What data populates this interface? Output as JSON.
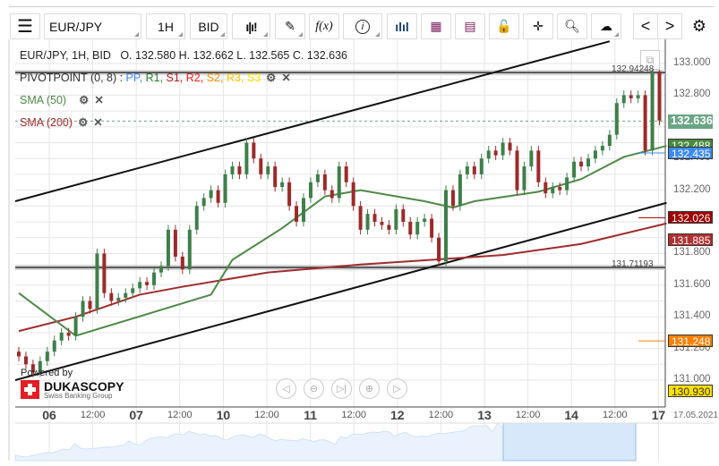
{
  "toolbar": {
    "menu_icon": "hamburger-icon",
    "symbol": "EUR/JPY",
    "period": "1H",
    "side": "BID",
    "chart_type_icon": "candles-icon",
    "draw_icon": "pencil-icon",
    "fx_label": "f(x)",
    "info_icon": "info-icon",
    "bars_icon": "volume-bars-icon",
    "calendar_icon": "calendar-icon",
    "news_icon": "news-icon",
    "lock_icon": "lock-icon",
    "crosshair_icon": "crosshair-icon",
    "zoom_icon": "zoom-icon",
    "upload_icon": "cloud-upload-icon",
    "prev": "<",
    "next": ">",
    "settings_icon": "gear-icon"
  },
  "header": {
    "title": "EUR/JPY, 1H, BID",
    "ohlc": "O. 132.580 H. 132.662 L. 132.565 C. 132.636"
  },
  "indicators": {
    "pivot": {
      "name": "PIVOTPOINT (0, 8)",
      "sep": " : ",
      "parts": [
        {
          "t": "PP",
          "c": "#3c8af0"
        },
        {
          "t": "R1",
          "c": "#2e7d32"
        },
        {
          "t": "S1",
          "c": "#b71c1c"
        },
        {
          "t": "R2",
          "c": "#ff1a1a"
        },
        {
          "t": "S2",
          "c": "#ff8c00"
        },
        {
          "t": "R3",
          "c": "#ffc000"
        },
        {
          "t": "S3",
          "c": "#ffe000"
        }
      ]
    },
    "sma50": {
      "label": "SMA (50)",
      "color": "#4e8a46"
    },
    "sma200": {
      "label": "SMA (200)",
      "color": "#a02c2c"
    }
  },
  "hlines": [
    {
      "label": "132.94248",
      "price": 132.94248
    },
    {
      "label": "131.71193",
      "price": 131.71193
    }
  ],
  "price_axis": {
    "ticks": [
      "133.000",
      "132.800",
      "132.600",
      "132.400",
      "132.200",
      "132.000",
      "131.800",
      "131.600",
      "131.400",
      "131.200",
      "131.000"
    ]
  },
  "badges": [
    {
      "text": "132.636",
      "price": 132.636,
      "color": "#6aa584"
    },
    {
      "text": "132.488",
      "price": 132.488,
      "color": "#4a8a3f"
    },
    {
      "text": "132.435",
      "price": 132.435,
      "color": "#3c8af0"
    },
    {
      "text": "132.026",
      "price": 132.026,
      "color": "#a00000"
    },
    {
      "text": "131.885",
      "price": 131.885,
      "color": "#b23030"
    },
    {
      "text": "131.248",
      "price": 131.248,
      "color": "#ff8000"
    },
    {
      "text": "130.930",
      "price": 130.93,
      "color": "#ffe000"
    }
  ],
  "time_axis": {
    "labels": [
      {
        "t": "06",
        "day": true
      },
      {
        "t": "12:00"
      },
      {
        "t": "07",
        "day": true
      },
      {
        "t": "12:00"
      },
      {
        "t": "10",
        "day": true
      },
      {
        "t": "12:00"
      },
      {
        "t": "11",
        "day": true
      },
      {
        "t": "12:00"
      },
      {
        "t": "12",
        "day": true
      },
      {
        "t": "12:00"
      },
      {
        "t": "13",
        "day": true
      },
      {
        "t": "12:00"
      },
      {
        "t": "14",
        "day": true
      },
      {
        "t": "12:00"
      },
      {
        "t": "17",
        "day": true
      }
    ],
    "date": "17.05.2021"
  },
  "branding": {
    "powered": "Powered by",
    "name": "DUKASCOPY",
    "sub": "Swiss Banking Group"
  },
  "nav_buttons": [
    "◁",
    "⊖",
    "▷|",
    "⊕",
    "▷"
  ],
  "chart_data": {
    "type": "candlestick",
    "interval": "2h",
    "ylim": [
      130.93,
      133.1
    ],
    "closes": [
      131.15,
      131.1,
      131.05,
      131.12,
      131.18,
      131.25,
      131.3,
      131.28,
      131.4,
      131.5,
      131.45,
      131.8,
      131.55,
      131.5,
      131.52,
      131.55,
      131.58,
      131.62,
      131.6,
      131.68,
      131.72,
      131.95,
      131.78,
      131.7,
      131.95,
      132.1,
      132.15,
      132.2,
      132.12,
      132.3,
      132.35,
      132.3,
      132.5,
      132.4,
      132.3,
      132.35,
      132.22,
      132.25,
      132.1,
      132.0,
      132.15,
      132.25,
      132.3,
      132.2,
      132.15,
      132.35,
      132.25,
      132.1,
      131.95,
      132.05,
      132.0,
      131.98,
      131.95,
      132.08,
      132.0,
      131.92,
      132.0,
      132.02,
      131.9,
      131.75,
      132.2,
      132.1,
      132.3,
      132.35,
      132.3,
      132.4,
      132.45,
      132.42,
      132.5,
      132.45,
      132.2,
      132.35,
      132.45,
      132.25,
      132.18,
      132.22,
      132.2,
      132.28,
      132.38,
      132.35,
      132.4,
      132.45,
      132.48,
      132.55,
      132.75,
      132.8,
      132.78,
      132.8,
      132.45,
      132.95,
      132.64
    ],
    "sma50": [
      [
        0,
        131.55
      ],
      [
        8,
        131.28
      ],
      [
        27,
        131.54
      ],
      [
        30,
        131.76
      ],
      [
        37,
        131.96
      ],
      [
        43,
        132.16
      ],
      [
        48,
        132.2
      ],
      [
        57,
        132.13
      ],
      [
        61,
        132.09
      ],
      [
        64,
        132.13
      ],
      [
        73,
        132.19
      ],
      [
        79,
        132.27
      ],
      [
        85,
        132.41
      ],
      [
        91,
        132.48
      ]
    ],
    "sma200": [
      [
        0,
        131.31
      ],
      [
        8,
        131.4
      ],
      [
        17,
        131.54
      ],
      [
        23,
        131.59
      ],
      [
        35,
        131.68
      ],
      [
        48,
        131.73
      ],
      [
        58,
        131.76
      ],
      [
        68,
        131.79
      ],
      [
        79,
        131.86
      ],
      [
        91,
        131.99
      ]
    ],
    "trendlines": [
      [
        [
          0,
          132.13
        ],
        [
          83,
          133.14
        ]
      ],
      [
        [
          0,
          131.0
        ],
        [
          91,
          132.12
        ]
      ],
      [
        [
          0,
          131.72
        ],
        [
          91,
          131.72
        ]
      ]
    ]
  }
}
